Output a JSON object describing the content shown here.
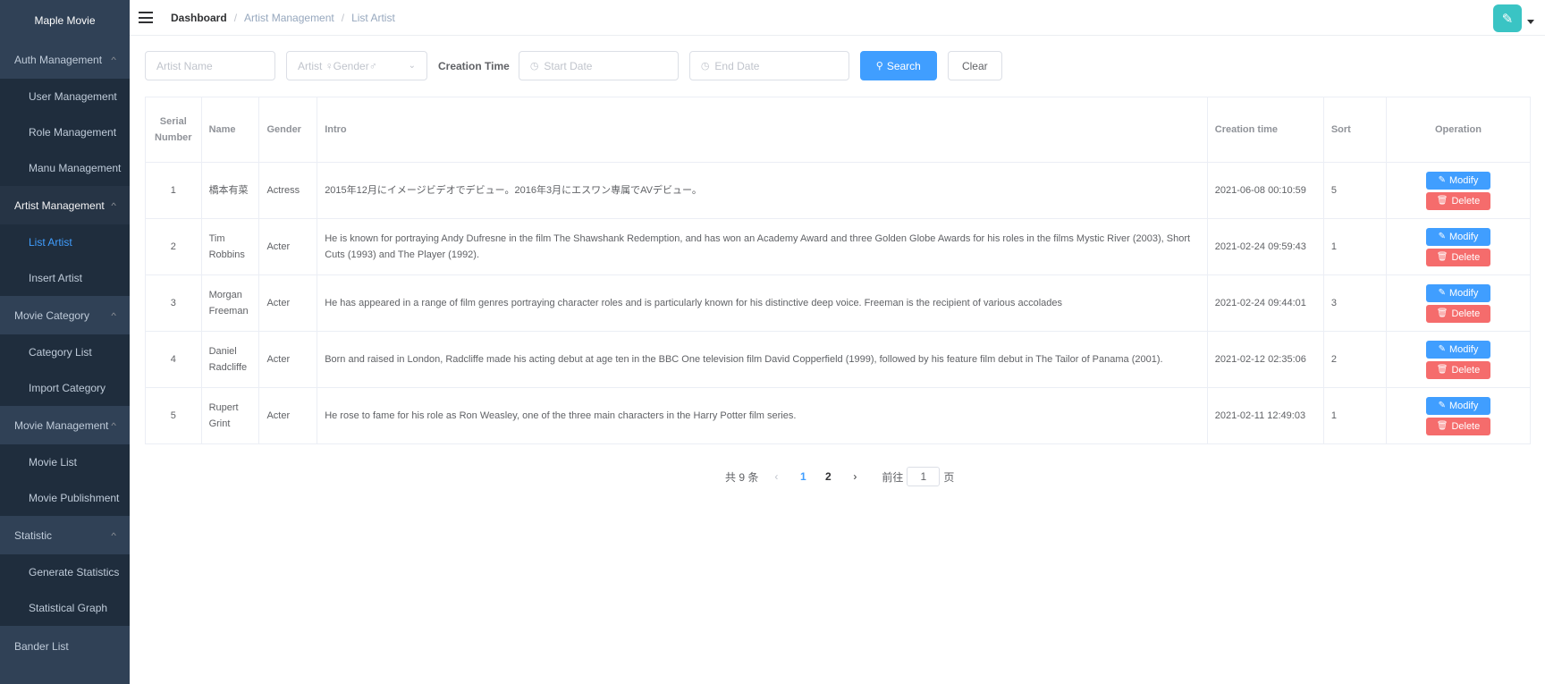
{
  "sidebar": {
    "brand": "Maple Movie",
    "groups": [
      {
        "label": "Auth Management",
        "items": [
          "User Management",
          "Role Management",
          "Manu Management"
        ]
      },
      {
        "label": "Artist Management",
        "items": [
          "List Artist",
          "Insert Artist"
        ]
      },
      {
        "label": "Movie Category",
        "items": [
          "Category List",
          "Import Category"
        ]
      },
      {
        "label": "Movie Management",
        "items": [
          "Movie List",
          "Movie Publishment"
        ]
      },
      {
        "label": "Statistic",
        "items": [
          "Generate Statistics",
          "Statistical Graph"
        ]
      },
      {
        "label": "Bander List",
        "items": []
      }
    ],
    "active_group": "Artist Management",
    "active_item": "List Artist"
  },
  "navbar": {
    "breadcrumb": [
      "Dashboard",
      "Artist Management",
      "List Artist"
    ],
    "avatar_icon": "brush-icon"
  },
  "filters": {
    "artist_name_placeholder": "Artist Name",
    "gender_placeholder": "Artist ♀Gender♂",
    "creation_time_label": "Creation Time",
    "start_date_placeholder": "Start Date",
    "end_date_placeholder": "End Date",
    "search_label": "Search",
    "clear_label": "Clear"
  },
  "table": {
    "headers": {
      "serial": "Serial Number",
      "name": "Name",
      "gender": "Gender",
      "intro": "Intro",
      "creation_time": "Creation time",
      "sort": "Sort",
      "operation": "Operation"
    },
    "rows": [
      {
        "serial": "1",
        "name": "橋本有菜",
        "gender": "Actress",
        "intro": "2015年12月にイメージビデオでデビュー。2016年3月にエスワン専属でAVデビュー。",
        "creation_time": "2021-06-08 00:10:59",
        "sort": "5"
      },
      {
        "serial": "2",
        "name": "Tim Robbins",
        "gender": "Acter",
        "intro": "He is known for portraying Andy Dufresne in the film The Shawshank Redemption, and has won an Academy Award and three Golden Globe Awards for his roles in the films Mystic River (2003), Short Cuts (1993) and The Player (1992).",
        "creation_time": "2021-02-24 09:59:43",
        "sort": "1"
      },
      {
        "serial": "3",
        "name": "Morgan Freeman",
        "gender": "Acter",
        "intro": "He has appeared in a range of film genres portraying character roles and is particularly known for his distinctive deep voice. Freeman is the recipient of various accolades",
        "creation_time": "2021-02-24 09:44:01",
        "sort": "3"
      },
      {
        "serial": "4",
        "name": "Daniel Radcliffe",
        "gender": "Acter",
        "intro": "Born and raised in London, Radcliffe made his acting debut at age ten in the BBC One television film David Copperfield (1999), followed by his feature film debut in The Tailor of Panama (2001).",
        "creation_time": "2021-02-12 02:35:06",
        "sort": "2"
      },
      {
        "serial": "5",
        "name": "Rupert Grint",
        "gender": "Acter",
        "intro": "He rose to fame for his role as Ron Weasley, one of the three main characters in the Harry Potter film series.",
        "creation_time": "2021-02-11 12:49:03",
        "sort": "1"
      }
    ],
    "modify_label": "Modify",
    "delete_label": "Delete"
  },
  "pagination": {
    "total_text": "共 9 条",
    "pages": [
      "1",
      "2"
    ],
    "current_page": "1",
    "goto_prefix": "前往",
    "goto_value": "1",
    "goto_suffix": "页"
  },
  "colors": {
    "sidebar_bg": "#304156",
    "submenu_bg": "#1f2d3d",
    "primary": "#409eff",
    "danger": "#f56c6c"
  }
}
